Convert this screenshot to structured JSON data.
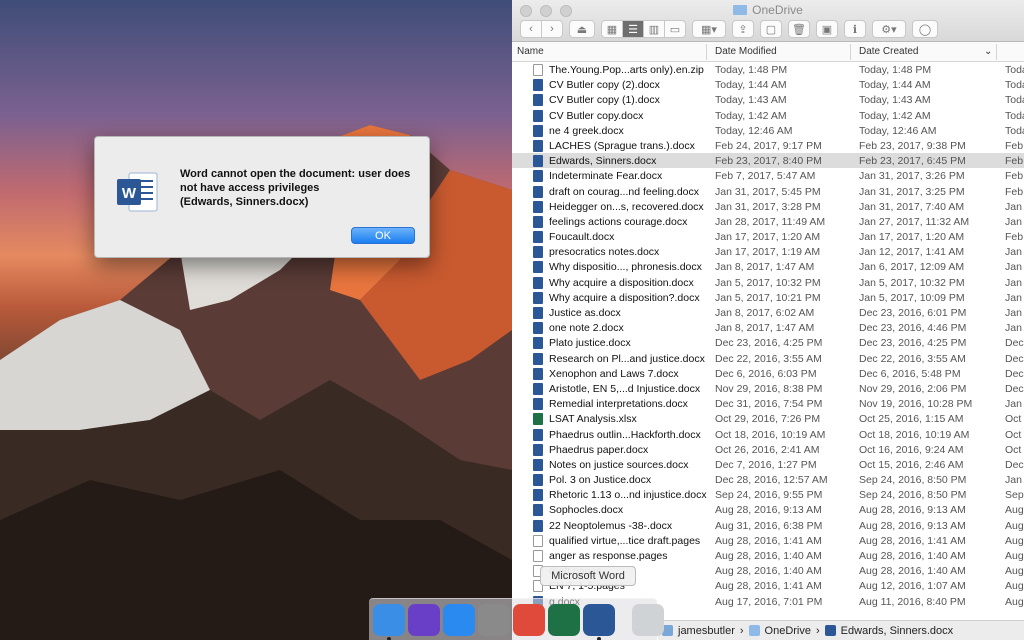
{
  "window": {
    "title": "OneDrive",
    "columns": [
      "Name",
      "Date Modified",
      "Date Created"
    ]
  },
  "files": [
    {
      "name": "The.Young.Pop...arts only).en.zip",
      "modified": "Today, 1:48 PM",
      "created": "Today, 1:48 PM",
      "extra": "Toda",
      "icon": "zip"
    },
    {
      "name": "CV Butler copy (2).docx",
      "modified": "Today, 1:44 AM",
      "created": "Today, 1:44 AM",
      "extra": "Toda",
      "icon": "word"
    },
    {
      "name": "CV Butler copy (1).docx",
      "modified": "Today, 1:43 AM",
      "created": "Today, 1:43 AM",
      "extra": "Toda",
      "icon": "word"
    },
    {
      "name": "CV Butler copy.docx",
      "modified": "Today, 1:42 AM",
      "created": "Today, 1:42 AM",
      "extra": "Toda",
      "icon": "word"
    },
    {
      "name": "ne 4 greek.docx",
      "modified": "Today, 12:46 AM",
      "created": "Today, 12:46 AM",
      "extra": "Toda",
      "icon": "word"
    },
    {
      "name": "LACHES (Sprague trans.).docx",
      "modified": "Feb 24, 2017, 9:17 PM",
      "created": "Feb 23, 2017, 9:38 PM",
      "extra": "Feb",
      "icon": "word"
    },
    {
      "name": "Edwards, Sinners.docx",
      "modified": "Feb 23, 2017, 8:40 PM",
      "created": "Feb 23, 2017, 6:45 PM",
      "extra": "Feb",
      "icon": "word",
      "selected": true
    },
    {
      "name": "Indeterminate Fear.docx",
      "modified": "Feb 7, 2017, 5:47 AM",
      "created": "Jan 31, 2017, 3:26 PM",
      "extra": "Feb",
      "icon": "word"
    },
    {
      "name": "draft on courag...nd feeling.docx",
      "modified": "Jan 31, 2017, 5:45 PM",
      "created": "Jan 31, 2017, 3:25 PM",
      "extra": "Feb",
      "icon": "word"
    },
    {
      "name": "Heidegger on...s, recovered.docx",
      "modified": "Jan 31, 2017, 3:28 PM",
      "created": "Jan 31, 2017, 7:40 AM",
      "extra": "Jan",
      "icon": "word"
    },
    {
      "name": "feelings actions courage.docx",
      "modified": "Jan 28, 2017, 11:49 AM",
      "created": "Jan 27, 2017, 11:32 AM",
      "extra": "Jan",
      "icon": "word"
    },
    {
      "name": "Foucault.docx",
      "modified": "Jan 17, 2017, 1:20 AM",
      "created": "Jan 17, 2017, 1:20 AM",
      "extra": "Feb",
      "icon": "word"
    },
    {
      "name": "presocratics notes.docx",
      "modified": "Jan 17, 2017, 1:19 AM",
      "created": "Jan 12, 2017, 1:41 AM",
      "extra": "Jan",
      "icon": "word"
    },
    {
      "name": "Why dispositio..., phronesis.docx",
      "modified": "Jan 8, 2017, 1:47 AM",
      "created": "Jan 6, 2017, 12:09 AM",
      "extra": "Jan",
      "icon": "word"
    },
    {
      "name": "Why acquire a disposition.docx",
      "modified": "Jan 5, 2017, 10:32 PM",
      "created": "Jan 5, 2017, 10:32 PM",
      "extra": "Jan",
      "icon": "word"
    },
    {
      "name": "Why acquire a disposition?.docx",
      "modified": "Jan 5, 2017, 10:21 PM",
      "created": "Jan 5, 2017, 10:09 PM",
      "extra": "Jan",
      "icon": "word"
    },
    {
      "name": "Justice as.docx",
      "modified": "Jan 8, 2017, 6:02 AM",
      "created": "Dec 23, 2016, 6:01 PM",
      "extra": "Jan",
      "icon": "word"
    },
    {
      "name": "one note 2.docx",
      "modified": "Jan 8, 2017, 1:47 AM",
      "created": "Dec 23, 2016, 4:46 PM",
      "extra": "Jan",
      "icon": "word"
    },
    {
      "name": "Plato justice.docx",
      "modified": "Dec 23, 2016, 4:25 PM",
      "created": "Dec 23, 2016, 4:25 PM",
      "extra": "Dec",
      "icon": "word"
    },
    {
      "name": "Research on Pl...and justice.docx",
      "modified": "Dec 22, 2016, 3:55 AM",
      "created": "Dec 22, 2016, 3:55 AM",
      "extra": "Dec",
      "icon": "word"
    },
    {
      "name": "Xenophon and Laws 7.docx",
      "modified": "Dec 6, 2016, 6:03 PM",
      "created": "Dec 6, 2016, 5:48 PM",
      "extra": "Dec",
      "icon": "word"
    },
    {
      "name": "Aristotle, EN 5,...d Injustice.docx",
      "modified": "Nov 29, 2016, 8:38 PM",
      "created": "Nov 29, 2016, 2:06 PM",
      "extra": "Dec",
      "icon": "word"
    },
    {
      "name": "Remedial interpretations.docx",
      "modified": "Dec 31, 2016, 7:54 PM",
      "created": "Nov 19, 2016, 10:28 PM",
      "extra": "Jan",
      "icon": "word"
    },
    {
      "name": "LSAT Analysis.xlsx",
      "modified": "Oct 29, 2016, 7:26 PM",
      "created": "Oct 25, 2016, 1:15 AM",
      "extra": "Oct",
      "icon": "excel"
    },
    {
      "name": "Phaedrus outlin...Hackforth.docx",
      "modified": "Oct 18, 2016, 10:19 AM",
      "created": "Oct 18, 2016, 10:19 AM",
      "extra": "Oct",
      "icon": "word"
    },
    {
      "name": "Phaedrus paper.docx",
      "modified": "Oct 26, 2016, 2:41 AM",
      "created": "Oct 16, 2016, 9:24 AM",
      "extra": "Oct",
      "icon": "word"
    },
    {
      "name": "Notes on justice sources.docx",
      "modified": "Dec 7, 2016, 1:27 PM",
      "created": "Oct 15, 2016, 2:46 AM",
      "extra": "Dec",
      "icon": "word"
    },
    {
      "name": "Pol. 3 on Justice.docx",
      "modified": "Dec 28, 2016, 12:57 AM",
      "created": "Sep 24, 2016, 8:50 PM",
      "extra": "Jan",
      "icon": "word"
    },
    {
      "name": "Rhetoric 1.13 o...nd injustice.docx",
      "modified": "Sep 24, 2016, 9:55 PM",
      "created": "Sep 24, 2016, 8:50 PM",
      "extra": "Sep",
      "icon": "word"
    },
    {
      "name": "Sophocles.docx",
      "modified": "Aug 28, 2016, 9:13 AM",
      "created": "Aug 28, 2016, 9:13 AM",
      "extra": "Aug",
      "icon": "word"
    },
    {
      "name": "22 Neoptolemus -38-.docx",
      "modified": "Aug 31, 2016, 6:38 PM",
      "created": "Aug 28, 2016, 9:13 AM",
      "extra": "Aug",
      "icon": "word"
    },
    {
      "name": "qualified virtue,...tice draft.pages",
      "modified": "Aug 28, 2016, 1:41 AM",
      "created": "Aug 28, 2016, 1:41 AM",
      "extra": "Aug",
      "icon": "pages"
    },
    {
      "name": "anger as response.pages",
      "modified": "Aug 28, 2016, 1:40 AM",
      "created": "Aug 28, 2016, 1:40 AM",
      "extra": "Aug",
      "icon": "pages"
    },
    {
      "name": "draft.pages",
      "modified": "Aug 28, 2016, 1:40 AM",
      "created": "Aug 28, 2016, 1:40 AM",
      "extra": "Aug",
      "icon": "pages"
    },
    {
      "name": "EN 7, 1-5.pages",
      "modified": "Aug 28, 2016, 1:41 AM",
      "created": "Aug 12, 2016, 1:07 AM",
      "extra": "Aug",
      "icon": "pages"
    },
    {
      "name": "g.docx",
      "modified": "Aug 17, 2016, 7:01 PM",
      "created": "Aug 11, 2016, 8:40 PM",
      "extra": "Aug",
      "icon": "word"
    }
  ],
  "pathbar": [
    "jamesbutler",
    "OneDrive",
    "Edwards, Sinners.docx"
  ],
  "dialog": {
    "message": "Word cannot open the document:  user does not have access privileges\n (Edwards, Sinners.docx)",
    "ok_label": "OK"
  },
  "dock": {
    "tooltip": "Microsoft Word",
    "apps": [
      {
        "name": "finder-icon",
        "color": "#3a8ee6"
      },
      {
        "name": "siri-icon",
        "color": "#6a3fc8"
      },
      {
        "name": "app-store-icon",
        "color": "#2a8af0"
      },
      {
        "name": "system-preferences-icon",
        "color": "#8a8a8a"
      },
      {
        "name": "chrome-icon",
        "color": "#e04a3a"
      },
      {
        "name": "excel-icon",
        "color": "#1e7145"
      },
      {
        "name": "word-icon",
        "color": "#2b5797"
      },
      {
        "name": "trash-icon",
        "color": "#cfd3d6"
      }
    ]
  }
}
